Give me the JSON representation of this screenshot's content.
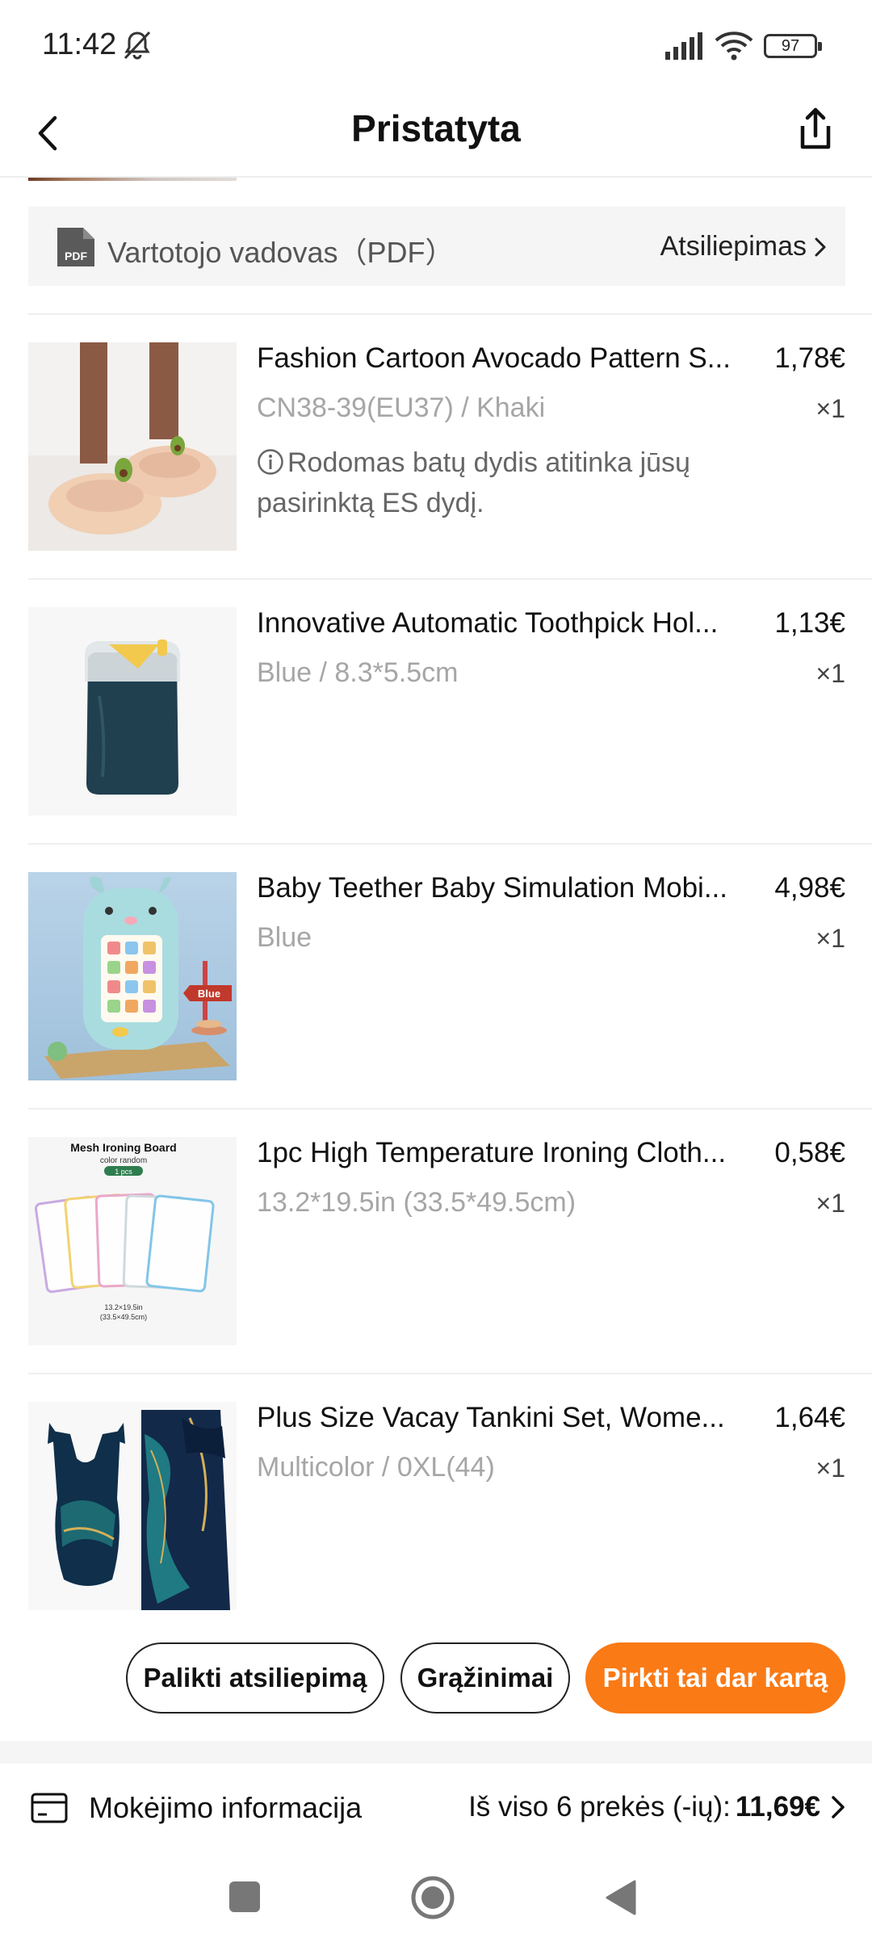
{
  "status_bar": {
    "time": "11:42",
    "battery": "97"
  },
  "header": {
    "title": "Pristatyta"
  },
  "manual": {
    "label": "Vartotojo vadovas（PDF）",
    "pdf_badge": "PDF",
    "feedback_link": "Atsiliepimas"
  },
  "items": [
    {
      "title": "Fashion Cartoon Avocado Pattern S...",
      "price": "1,78€",
      "variant": "CN38-39(EU37) / Khaki",
      "qty": "×1",
      "note": "Rodomas batų dydis atitinka jūsų pasirinktą ES dydį."
    },
    {
      "title": "Innovative Automatic Toothpick Hol...",
      "price": "1,13€",
      "variant": "Blue / 8.3*5.5cm",
      "qty": "×1"
    },
    {
      "title": "Baby Teether Baby Simulation Mobi...",
      "price": "4,98€",
      "variant": "Blue",
      "qty": "×1",
      "image_label": "Blue"
    },
    {
      "title": "1pc High Temperature Ironing Cloth...",
      "price": "0,58€",
      "variant": "13.2*19.5in (33.5*49.5cm)",
      "qty": "×1",
      "image_title": "Mesh Ironing Board",
      "image_subtitle": "color random",
      "image_badge": "1 pcs",
      "image_size_1": "13.2×19.5in",
      "image_size_2": "(33.5×49.5cm)"
    },
    {
      "title": "Plus Size Vacay Tankini Set, Wome...",
      "price": "1,64€",
      "variant": "Multicolor / 0XL(44)",
      "qty": "×1"
    }
  ],
  "actions": {
    "leave_review": "Palikti atsiliepimą",
    "returns": "Grąžinimai",
    "buy_again": "Pirkti tai dar kartą"
  },
  "payment": {
    "label": "Mokėjimo informacija",
    "total_label": "Iš viso 6 prekės (-ių):",
    "total_amount": "11,69€"
  },
  "colors": {
    "accent": "#fa7a16",
    "muted": "#a6a6a6",
    "section_bg": "#f5f5f5"
  }
}
